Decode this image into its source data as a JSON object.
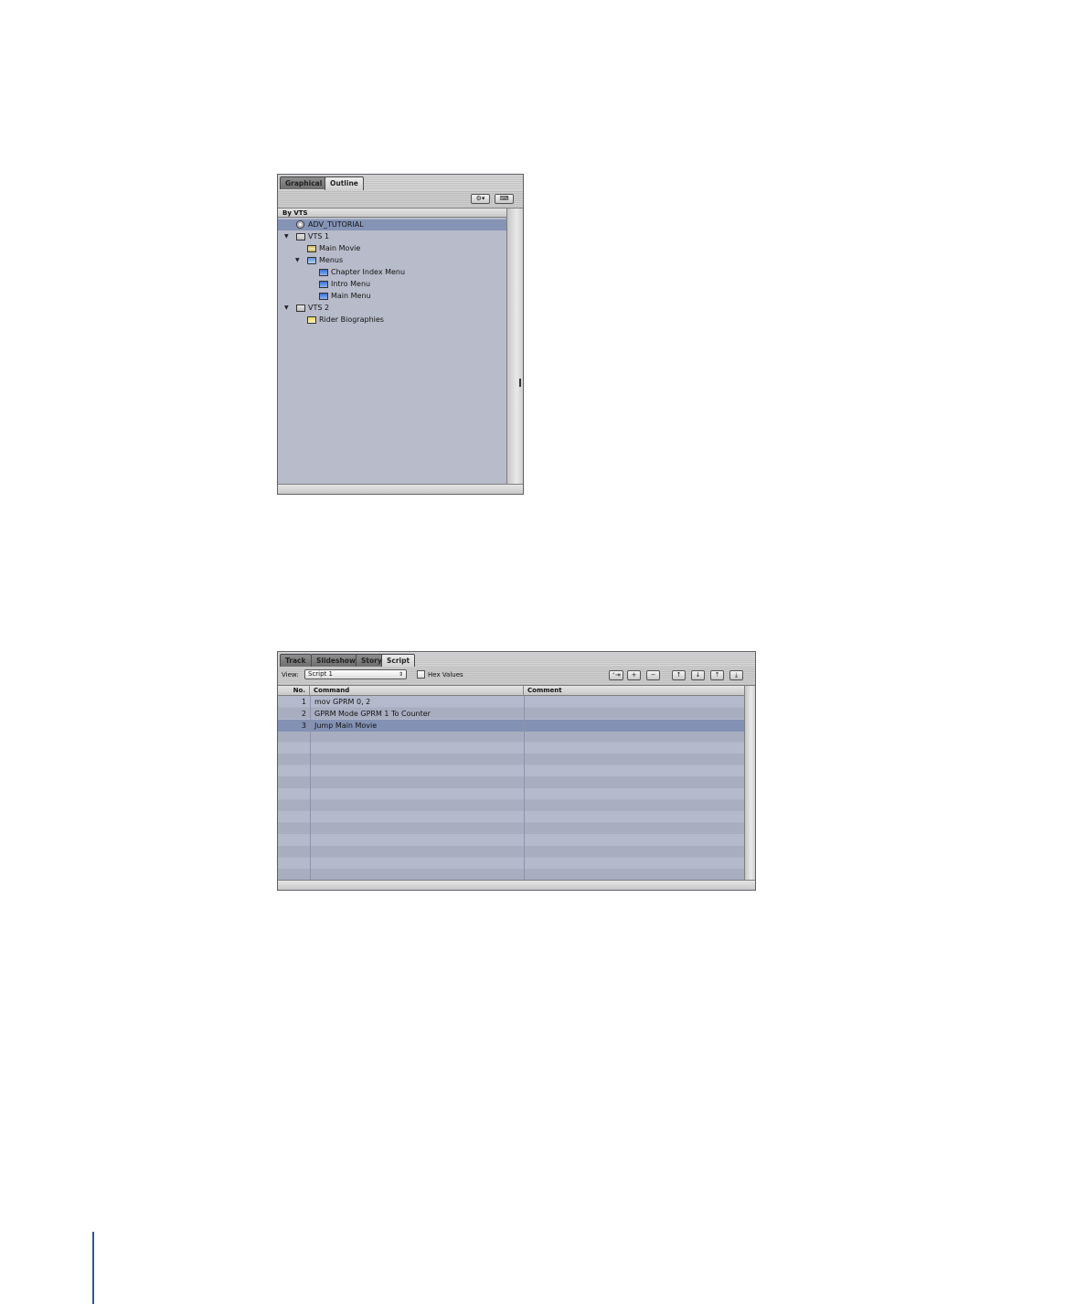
{
  "outline": {
    "tabs": [
      {
        "label": "Graphical",
        "active": false
      },
      {
        "label": "Outline",
        "active": true
      }
    ],
    "column_header": "By VTS",
    "tree": [
      {
        "label": "ADV_TUTORIAL",
        "icon": "disc-icon",
        "selected": true,
        "disclosure": ""
      },
      {
        "label": "VTS 1",
        "icon": "vts-icon",
        "disclosure": "▼"
      },
      {
        "label": "Main Movie",
        "icon": "track-icon",
        "disclosure": ""
      },
      {
        "label": "Menus",
        "icon": "folder-icon",
        "disclosure": "▼"
      },
      {
        "label": "Chapter Index Menu",
        "icon": "menu-icon",
        "disclosure": ""
      },
      {
        "label": "Intro Menu",
        "icon": "menu-icon",
        "disclosure": ""
      },
      {
        "label": "Main Menu",
        "icon": "menu-icon",
        "disclosure": ""
      },
      {
        "label": "VTS 2",
        "icon": "vts-icon",
        "disclosure": "▼"
      },
      {
        "label": "Rider Biographies",
        "icon": "story-icon",
        "disclosure": ""
      }
    ]
  },
  "script_editor": {
    "tabs": [
      {
        "label": "Track",
        "active": false
      },
      {
        "label": "Slideshow",
        "active": false
      },
      {
        "label": "Story",
        "active": false
      },
      {
        "label": "Script",
        "active": true
      }
    ],
    "view_label": "View:",
    "view_value": "Script 1",
    "hex_label": "Hex Values",
    "hex_checked": false,
    "columns": [
      "No.",
      "Command",
      "Comment"
    ],
    "rows": [
      {
        "no": "1",
        "command": "mov GPRM 0, 2",
        "selected": false
      },
      {
        "no": "2",
        "command": "GPRM Mode GPRM 1 To Counter",
        "selected": false
      },
      {
        "no": "3",
        "command": "Jump Main Movie",
        "selected": true
      }
    ],
    "buttons": [
      "insert-command-icon",
      "add-icon",
      "remove-icon",
      "move-up-icon",
      "move-down-icon",
      "move-to-top-icon",
      "move-to-bottom-icon"
    ]
  },
  "colors": {
    "selection": "#8593b5",
    "list_background": "#b7bbca"
  }
}
